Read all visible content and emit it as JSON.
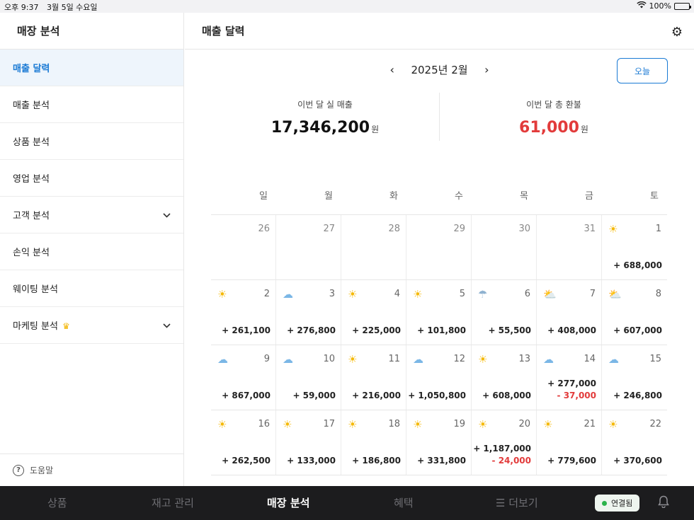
{
  "status_bar": {
    "time": "오후 9:37",
    "date": "3월 5일 수요일",
    "battery": "100%",
    "wifi_icon": "wifi-icon"
  },
  "sidebar": {
    "title": "매장 분석",
    "items": [
      {
        "label": "매출 달력",
        "active": true,
        "expandable": false
      },
      {
        "label": "매출 분석",
        "active": false,
        "expandable": false
      },
      {
        "label": "상품 분석",
        "active": false,
        "expandable": false
      },
      {
        "label": "영업 분석",
        "active": false,
        "expandable": false
      },
      {
        "label": "고객 분석",
        "active": false,
        "expandable": true
      },
      {
        "label": "손익 분석",
        "active": false,
        "expandable": false
      },
      {
        "label": "웨이팅 분석",
        "active": false,
        "expandable": false
      },
      {
        "label": "마케팅 분석",
        "active": false,
        "expandable": true,
        "badge": "crown-icon"
      }
    ],
    "help_label": "도움말"
  },
  "main": {
    "title": "매출 달력",
    "settings_icon": "gear-icon",
    "month_label": "2025년 2월",
    "prev_arrow": "‹",
    "next_arrow": "›",
    "today_label": "오늘",
    "summary": {
      "net_sales_label": "이번 달 실 매출",
      "net_sales_value": "17,346,200",
      "refund_label": "이번 달 총 환불",
      "refund_value": "61,000",
      "unit": "원"
    },
    "weekdays": [
      "일",
      "월",
      "화",
      "수",
      "목",
      "금",
      "토"
    ],
    "weeks": [
      [
        {
          "day": "26",
          "weather": "",
          "sale": "",
          "refund": "",
          "faded": true
        },
        {
          "day": "27",
          "weather": "",
          "sale": "",
          "refund": "",
          "faded": true
        },
        {
          "day": "28",
          "weather": "",
          "sale": "",
          "refund": "",
          "faded": true
        },
        {
          "day": "29",
          "weather": "",
          "sale": "",
          "refund": "",
          "faded": true
        },
        {
          "day": "30",
          "weather": "",
          "sale": "",
          "refund": "",
          "faded": true
        },
        {
          "day": "31",
          "weather": "",
          "sale": "",
          "refund": "",
          "faded": true
        },
        {
          "day": "1",
          "weather": "sun",
          "sale": "+ 688,000",
          "refund": "",
          "faded": false
        }
      ],
      [
        {
          "day": "2",
          "weather": "sun",
          "sale": "+ 261,100",
          "refund": ""
        },
        {
          "day": "3",
          "weather": "cloud",
          "sale": "+ 276,800",
          "refund": ""
        },
        {
          "day": "4",
          "weather": "sun",
          "sale": "+ 225,000",
          "refund": ""
        },
        {
          "day": "5",
          "weather": "sun",
          "sale": "+ 101,800",
          "refund": ""
        },
        {
          "day": "6",
          "weather": "rain",
          "sale": "+ 55,500",
          "refund": ""
        },
        {
          "day": "7",
          "weather": "partly",
          "sale": "+ 408,000",
          "refund": ""
        },
        {
          "day": "8",
          "weather": "partly",
          "sale": "+ 607,000",
          "refund": ""
        }
      ],
      [
        {
          "day": "9",
          "weather": "cloud",
          "sale": "+ 867,000",
          "refund": ""
        },
        {
          "day": "10",
          "weather": "cloud",
          "sale": "+ 59,000",
          "refund": ""
        },
        {
          "day": "11",
          "weather": "sun",
          "sale": "+ 216,000",
          "refund": ""
        },
        {
          "day": "12",
          "weather": "cloud",
          "sale": "+ 1,050,800",
          "refund": ""
        },
        {
          "day": "13",
          "weather": "sun",
          "sale": "+ 608,000",
          "refund": ""
        },
        {
          "day": "14",
          "weather": "cloud",
          "sale": "+ 277,000",
          "refund": "- 37,000"
        },
        {
          "day": "15",
          "weather": "cloud",
          "sale": "+ 246,800",
          "refund": ""
        }
      ],
      [
        {
          "day": "16",
          "weather": "sun",
          "sale": "+ 262,500",
          "refund": ""
        },
        {
          "day": "17",
          "weather": "sun",
          "sale": "+ 133,000",
          "refund": ""
        },
        {
          "day": "18",
          "weather": "sun",
          "sale": "+ 186,800",
          "refund": ""
        },
        {
          "day": "19",
          "weather": "sun",
          "sale": "+ 331,800",
          "refund": ""
        },
        {
          "day": "20",
          "weather": "sun",
          "sale": "+ 1,187,000",
          "refund": "- 24,000"
        },
        {
          "day": "21",
          "weather": "sun",
          "sale": "+ 779,600",
          "refund": ""
        },
        {
          "day": "22",
          "weather": "sun",
          "sale": "+ 370,600",
          "refund": ""
        }
      ]
    ]
  },
  "tabbar": {
    "tabs": [
      {
        "label": "상품",
        "active": false
      },
      {
        "label": "재고 관리",
        "active": false
      },
      {
        "label": "매장 분석",
        "active": true
      },
      {
        "label": "혜택",
        "active": false
      },
      {
        "label": "더보기",
        "active": false,
        "icon": "menu-icon"
      }
    ],
    "connection_label": "연결됨",
    "connection_color": "#2bb34b",
    "bell_icon": "bell-icon"
  },
  "colors": {
    "accent": "#1a7ad4",
    "refund_red": "#e23b3b",
    "tabbar_bg": "#1c1c1e"
  }
}
